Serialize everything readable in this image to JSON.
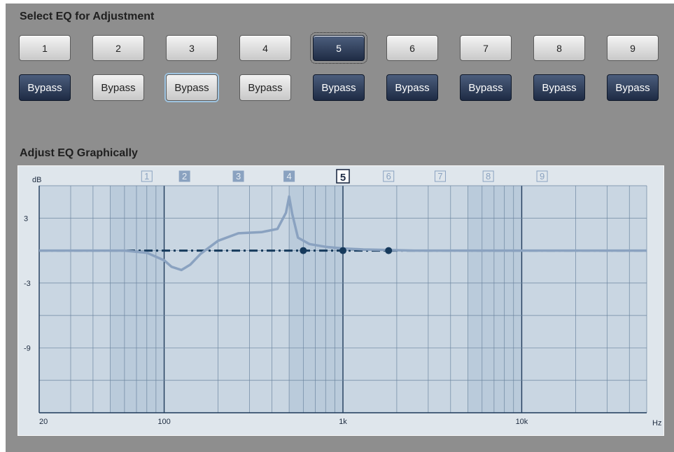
{
  "select_section": {
    "title": "Select EQ for Adjustment",
    "selected_band": "5",
    "bands": [
      {
        "label": "1",
        "bypass_label": "Bypass",
        "bypass_active": true
      },
      {
        "label": "2",
        "bypass_label": "Bypass",
        "bypass_active": false
      },
      {
        "label": "3",
        "bypass_label": "Bypass",
        "bypass_active": false
      },
      {
        "label": "4",
        "bypass_label": "Bypass",
        "bypass_active": false
      },
      {
        "label": "5",
        "bypass_label": "Bypass",
        "bypass_active": true
      },
      {
        "label": "6",
        "bypass_label": "Bypass",
        "bypass_active": true
      },
      {
        "label": "7",
        "bypass_label": "Bypass",
        "bypass_active": true
      },
      {
        "label": "8",
        "bypass_label": "Bypass",
        "bypass_active": true
      },
      {
        "label": "9",
        "bypass_label": "Bypass",
        "bypass_active": true
      }
    ]
  },
  "graph_section": {
    "title": "Adjust EQ Graphically",
    "y_unit": "dB",
    "x_unit": "Hz",
    "y_tick_labels": [
      "3",
      "-3",
      "-9"
    ],
    "x_tick_labels": [
      "20",
      "100",
      "1k",
      "10k"
    ],
    "band_markers": [
      {
        "label": "1",
        "freq": 80,
        "style": "outline"
      },
      {
        "label": "2",
        "freq": 130,
        "style": "filled"
      },
      {
        "label": "3",
        "freq": 260,
        "style": "filled"
      },
      {
        "label": "4",
        "freq": 500,
        "style": "filled"
      },
      {
        "label": "5",
        "freq": 1000,
        "style": "selected"
      },
      {
        "label": "6",
        "freq": 1800,
        "style": "outline"
      },
      {
        "label": "7",
        "freq": 3500,
        "style": "outline"
      },
      {
        "label": "8",
        "freq": 6500,
        "style": "outline"
      },
      {
        "label": "9",
        "freq": 13000,
        "style": "outline"
      }
    ],
    "shaded_band_freqs": [
      100,
      1000,
      10000
    ],
    "colors": {
      "selected": "#1f2c45",
      "curve": "#8aa2c0",
      "flat_line": "#163a5c",
      "grid": "#34506f"
    }
  },
  "chart_data": {
    "type": "line",
    "xlim": [
      20,
      50000
    ],
    "x_scale": "log",
    "ylim": [
      -15,
      6
    ],
    "series": [
      {
        "name": "",
        "style": "dash-dot",
        "x": [
          20,
          50000
        ],
        "y": [
          0,
          0
        ]
      },
      {
        "name": "",
        "style": "solid",
        "x": [
          20,
          60,
          80,
          100,
          110,
          125,
          140,
          160,
          200,
          260,
          350,
          430,
          480,
          500,
          520,
          560,
          650,
          800,
          1000,
          1300,
          1800,
          2500,
          50000
        ],
        "y": [
          0,
          0,
          -0.2,
          -0.9,
          -1.5,
          -1.8,
          -1.3,
          -0.3,
          0.9,
          1.6,
          1.7,
          2.0,
          3.5,
          5.0,
          3.4,
          1.2,
          0.6,
          0.35,
          0.2,
          0.1,
          0.05,
          0,
          0
        ]
      }
    ],
    "control_points": [
      {
        "x": 600,
        "y": 0
      },
      {
        "x": 1000,
        "y": 0
      },
      {
        "x": 1800,
        "y": 0
      }
    ]
  }
}
